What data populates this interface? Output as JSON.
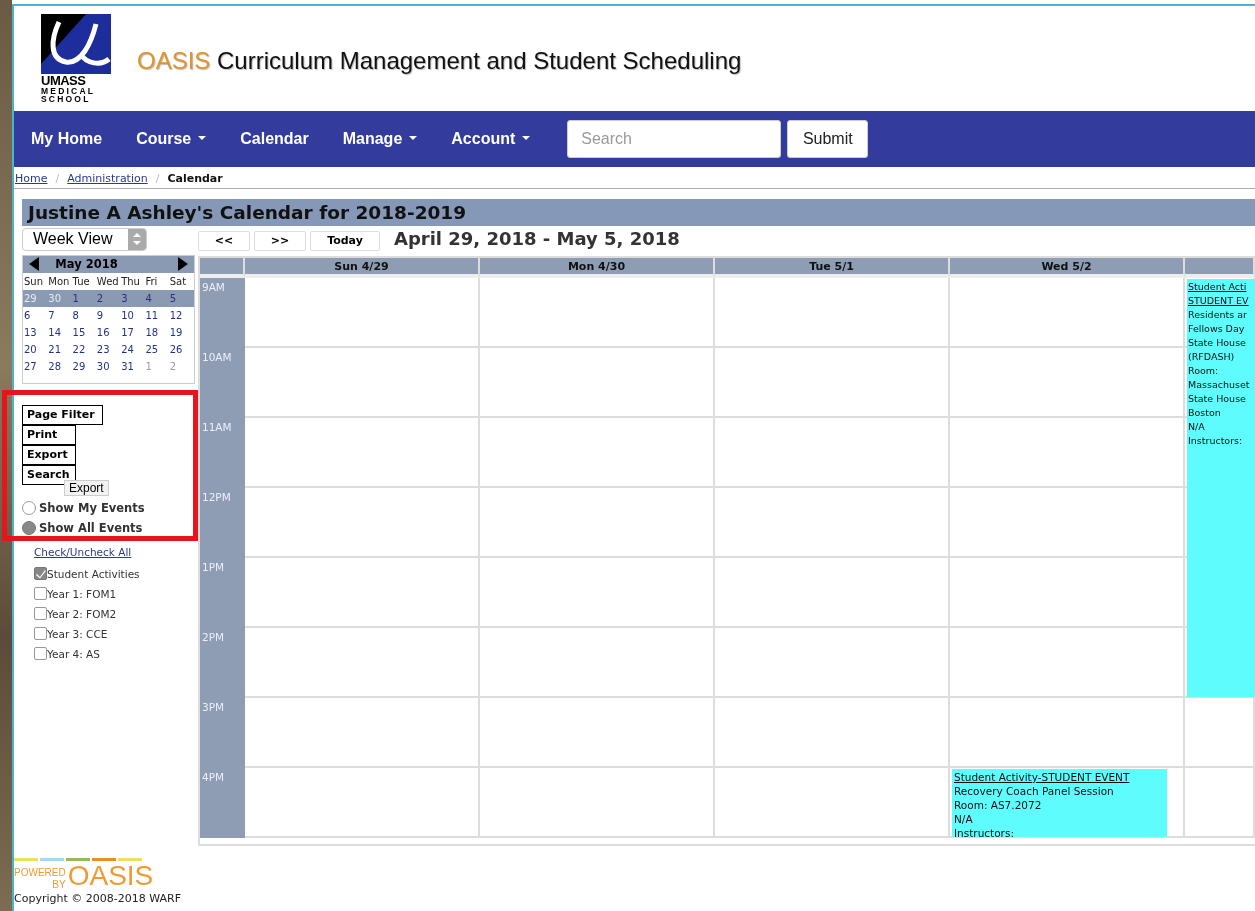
{
  "header": {
    "logo": {
      "lines": [
        "UMASS",
        "MEDICAL",
        "SCHOOL"
      ]
    },
    "title_brand": "OASIS",
    "title": "Curriculum Management and Student Scheduling"
  },
  "nav": {
    "items": [
      {
        "label": "My Home",
        "dropdown": false
      },
      {
        "label": "Course",
        "dropdown": true
      },
      {
        "label": "Calendar",
        "dropdown": false
      },
      {
        "label": "Manage",
        "dropdown": true
      },
      {
        "label": "Account",
        "dropdown": true
      }
    ],
    "search": {
      "placeholder": "Search"
    },
    "submit": "Submit"
  },
  "breadcrumb": {
    "separator": "/",
    "items": [
      {
        "label": "Home",
        "link": true
      },
      {
        "label": "Administration",
        "link": true
      },
      {
        "label": "Calendar",
        "link": false
      }
    ]
  },
  "calendar_title": "Justine A Ashley's Calendar for 2018-2019",
  "view_select": {
    "value": "Week View"
  },
  "mini_calendar": {
    "month": "May 2018",
    "weekdays": [
      "Sun",
      "Mon",
      "Tue",
      "Wed",
      "Thu",
      "Fri",
      "Sat"
    ],
    "weeks": [
      {
        "selected": true,
        "days": [
          {
            "label": "29",
            "other_month": true
          },
          {
            "label": "30",
            "other_month": true
          },
          {
            "label": "1",
            "other_month": false
          },
          {
            "label": "2",
            "other_month": false
          },
          {
            "label": "3",
            "other_month": false
          },
          {
            "label": "4",
            "other_month": false
          },
          {
            "label": "5",
            "other_month": false
          }
        ]
      },
      {
        "selected": false,
        "days": [
          {
            "label": "6",
            "other_month": false
          },
          {
            "label": "7",
            "other_month": false
          },
          {
            "label": "8",
            "other_month": false
          },
          {
            "label": "9",
            "other_month": false
          },
          {
            "label": "10",
            "other_month": false
          },
          {
            "label": "11",
            "other_month": false
          },
          {
            "label": "12",
            "other_month": false
          }
        ]
      },
      {
        "selected": false,
        "days": [
          {
            "label": "13",
            "other_month": false
          },
          {
            "label": "14",
            "other_month": false
          },
          {
            "label": "15",
            "other_month": false
          },
          {
            "label": "16",
            "other_month": false
          },
          {
            "label": "17",
            "other_month": false
          },
          {
            "label": "18",
            "other_month": false
          },
          {
            "label": "19",
            "other_month": false
          }
        ]
      },
      {
        "selected": false,
        "days": [
          {
            "label": "20",
            "other_month": false
          },
          {
            "label": "21",
            "other_month": false
          },
          {
            "label": "22",
            "other_month": false
          },
          {
            "label": "23",
            "other_month": false
          },
          {
            "label": "24",
            "other_month": false
          },
          {
            "label": "25",
            "other_month": false
          },
          {
            "label": "26",
            "other_month": false
          }
        ]
      },
      {
        "selected": false,
        "days": [
          {
            "label": "27",
            "other_month": false
          },
          {
            "label": "28",
            "other_month": false
          },
          {
            "label": "29",
            "other_month": false
          },
          {
            "label": "30",
            "other_month": false
          },
          {
            "label": "31",
            "other_month": false
          },
          {
            "label": "1",
            "other_month": true
          },
          {
            "label": "2",
            "other_month": true
          }
        ]
      }
    ]
  },
  "sidebar_buttons": [
    "Page Filter",
    "Print",
    "Export",
    "Search"
  ],
  "tooltip": "Export",
  "event_filter": [
    {
      "label": "Show My Events",
      "selected": false
    },
    {
      "label": "Show All Events",
      "selected": true
    }
  ],
  "check_all_link": "Check/Uncheck All",
  "categories": [
    {
      "label": "Student Activities",
      "checked": true
    },
    {
      "label": "Year 1: FOM1",
      "checked": false
    },
    {
      "label": "Year 2: FOM2",
      "checked": false
    },
    {
      "label": "Year 3: CCE",
      "checked": false
    },
    {
      "label": "Year 4: AS",
      "checked": false
    }
  ],
  "nav_buttons": [
    "<<",
    ">>",
    "Today"
  ],
  "date_range": "April 29, 2018 - May 5, 2018",
  "week": {
    "hours": [
      "9AM",
      "10AM",
      "11AM",
      "12PM",
      "1PM",
      "2PM",
      "3PM",
      "4PM"
    ],
    "columns": [
      {
        "header": "Sun 4/29",
        "cells": [
          {
            "kind": "empty"
          },
          {
            "kind": "empty"
          },
          {
            "kind": "empty"
          },
          {
            "kind": "empty"
          },
          {
            "kind": "empty"
          },
          {
            "kind": "empty"
          },
          {
            "kind": "empty"
          },
          {
            "kind": "empty"
          }
        ]
      },
      {
        "header": "Mon 4/30",
        "cells": [
          {
            "kind": "empty"
          },
          {
            "kind": "empty"
          },
          {
            "kind": "empty"
          },
          {
            "kind": "empty"
          },
          {
            "kind": "empty"
          },
          {
            "kind": "empty"
          },
          {
            "kind": "empty"
          },
          {
            "kind": "empty"
          }
        ]
      },
      {
        "header": "Tue 5/1",
        "cells": [
          {
            "kind": "empty"
          },
          {
            "kind": "empty"
          },
          {
            "kind": "empty"
          },
          {
            "kind": "empty"
          },
          {
            "kind": "empty"
          },
          {
            "kind": "empty"
          },
          {
            "kind": "empty"
          },
          {
            "kind": "empty"
          }
        ]
      },
      {
        "header": "Wed 5/2",
        "cells": [
          {
            "kind": "empty"
          },
          {
            "kind": "empty"
          },
          {
            "kind": "empty"
          },
          {
            "kind": "empty"
          },
          {
            "kind": "empty"
          },
          {
            "kind": "empty"
          },
          {
            "kind": "empty"
          },
          {
            "kind": "event",
            "title_lines": [
              "Student Activity-STUDENT EVENT"
            ],
            "lines": [
              "Recovery Coach Panel Session",
              "Room: AS7.2072",
              "N/A",
              "Instructors:"
            ]
          }
        ]
      },
      {
        "cells": [
          {
            "kind": "event",
            "title_lines": [
              "Student Acti",
              "STUDENT EV"
            ],
            "lines": [
              "Residents ar",
              "Fellows Day",
              "State House",
              "(RFDASH)",
              "Room:",
              "Massachuset",
              "State House",
              "Boston",
              "N/A",
              "Instructors:"
            ]
          },
          {
            "kind": "continued"
          },
          {
            "kind": "continued"
          },
          {
            "kind": "continued"
          },
          {
            "kind": "continued"
          },
          {
            "kind": "continued"
          },
          {
            "kind": "empty"
          },
          {
            "kind": "empty"
          }
        ]
      }
    ]
  },
  "highlight_box": {
    "color": "#e8141c"
  },
  "footer": {
    "powered": [
      "POWERED",
      "BY"
    ],
    "brand": "OASIS",
    "copyright": "Copyright © 2008-2018 WARF"
  }
}
